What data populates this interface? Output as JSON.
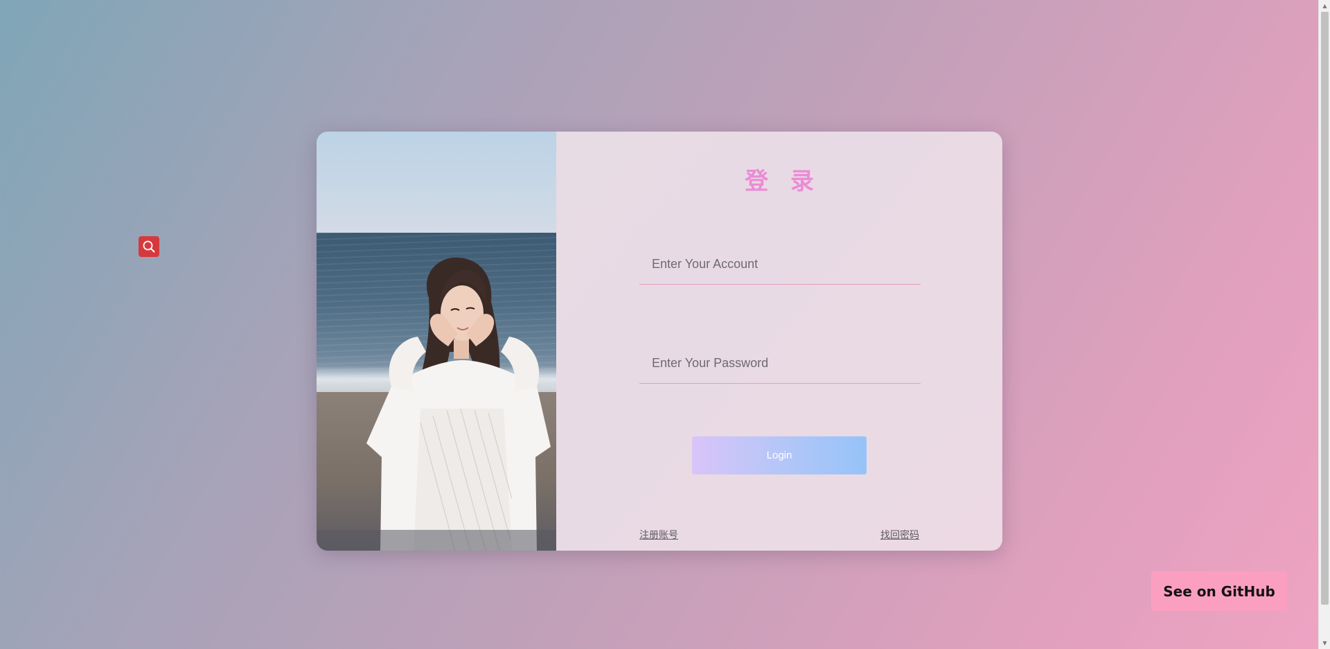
{
  "colors": {
    "accent_title": "#ec8bd6",
    "underline": "#e79cc1",
    "login_gradient": [
      "#d9c4f8",
      "#96c3f8"
    ],
    "github_button": "#fb9fc0",
    "float_search": "#d6393d"
  },
  "float_widget": {
    "icon": "search-icon"
  },
  "login": {
    "title": "登 录",
    "account_placeholder": "Enter Your Account",
    "account_value": "",
    "password_placeholder": "Enter Your Password",
    "password_value": "",
    "submit_label": "Login",
    "register_link": "注册账号",
    "forgot_link": "找回密码"
  },
  "github": {
    "label": "See on GitHub"
  }
}
